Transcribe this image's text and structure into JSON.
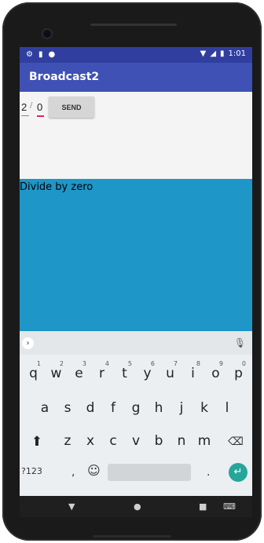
{
  "status_bar": {
    "icons_left": [
      "gear-icon",
      "sd-card-icon",
      "circle-icon"
    ],
    "icons_right": [
      "wifi-icon",
      "signal-icon",
      "battery-icon"
    ],
    "time": "1:01"
  },
  "app_bar": {
    "title": "Broadcast2"
  },
  "form": {
    "numerator": "2",
    "separator": "/",
    "denominator": "0",
    "send_label": "SEND"
  },
  "result": {
    "text": "Divide by zero"
  },
  "keyboard": {
    "row1": [
      {
        "key": "q",
        "hint": "1"
      },
      {
        "key": "w",
        "hint": "2"
      },
      {
        "key": "e",
        "hint": "3"
      },
      {
        "key": "r",
        "hint": "4"
      },
      {
        "key": "t",
        "hint": "5"
      },
      {
        "key": "y",
        "hint": "6"
      },
      {
        "key": "u",
        "hint": "7"
      },
      {
        "key": "i",
        "hint": "8"
      },
      {
        "key": "o",
        "hint": "9"
      },
      {
        "key": "p",
        "hint": "0"
      }
    ],
    "row2": [
      "a",
      "s",
      "d",
      "f",
      "g",
      "h",
      "j",
      "k",
      "l"
    ],
    "row3": [
      "z",
      "x",
      "c",
      "v",
      "b",
      "n",
      "m"
    ],
    "symbols_label": "?123",
    "comma": ",",
    "period": "."
  },
  "colors": {
    "status_bar": "#303f9f",
    "app_bar": "#3f51b5",
    "result_area": "#1e96c8",
    "field_focus": "#e91e63",
    "enter_key": "#26a69a"
  }
}
